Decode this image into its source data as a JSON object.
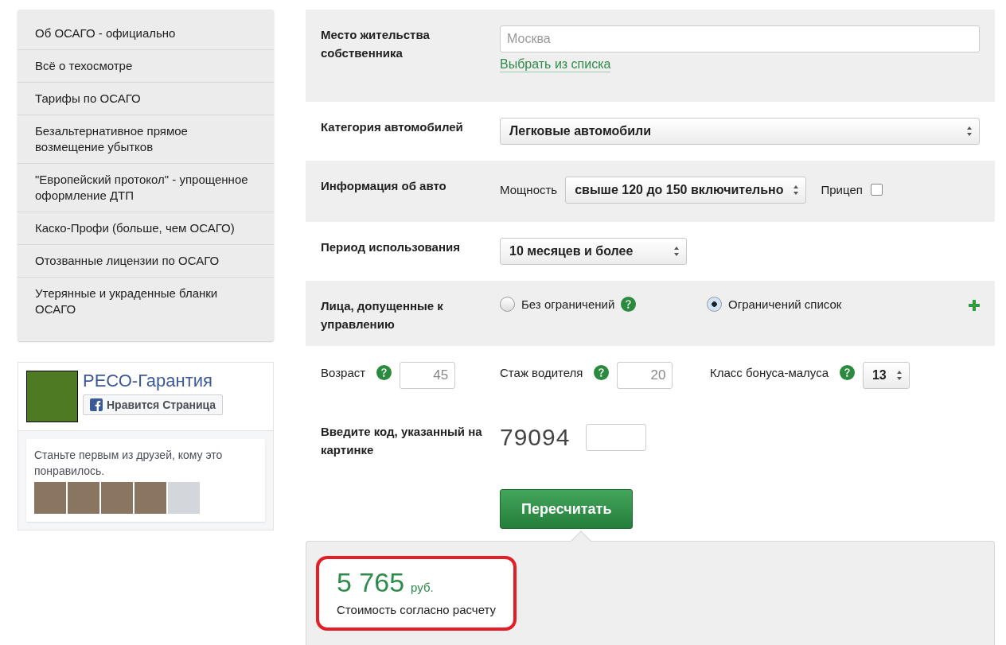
{
  "sidebar": {
    "items": [
      {
        "label": "Об ОСАГО - официально"
      },
      {
        "label": "Всё о техосмотре"
      },
      {
        "label": "Тарифы по ОСАГО"
      },
      {
        "label": "Безальтернативное прямое возмещение убытков"
      },
      {
        "label": "\"Европейский протокол\" - упрощенное оформление ДТП"
      },
      {
        "label": "Каско-Профи (больше, чем ОСАГО)"
      },
      {
        "label": "Отозванные лицензии по ОСАГО"
      },
      {
        "label": "Утерянные и украденные бланки ОСАГО"
      }
    ]
  },
  "social_widget": {
    "page_name": "РЕСО-Гарантия",
    "like_button": "Нравится Страница",
    "message": "Станьте первым из друзей, кому это понравилось.",
    "friends": [
      {
        "kind": "photo"
      },
      {
        "kind": "photo"
      },
      {
        "kind": "photo"
      },
      {
        "kind": "photo"
      },
      {
        "kind": "silhouette"
      }
    ]
  },
  "form": {
    "residence": {
      "label": "Место жительства собственника",
      "placeholder": "Москва",
      "link": "Выбрать из списка"
    },
    "category": {
      "label": "Категория автомобилей",
      "value": "Легковые автомобили"
    },
    "car_info": {
      "label": "Информация об авто",
      "power_label": "Мощность",
      "power_value": "свыше 120 до 150 включительно",
      "trailer_label": "Прицеп",
      "trailer_checked": false
    },
    "period": {
      "label": "Период использования",
      "value": "10 месяцев и более"
    },
    "drivers": {
      "label": "Лица, допущенные к управлению",
      "options": [
        {
          "label": "Без ограничений",
          "selected": false,
          "help": true
        },
        {
          "label": "Ограничений список",
          "selected": true,
          "help": false
        }
      ]
    },
    "driver_fields": [
      {
        "label": "Возраст",
        "kind": "input",
        "value": "45"
      },
      {
        "label": "Стаж водителя",
        "kind": "input",
        "value": "20"
      },
      {
        "label": "Класс бонуса-малуса",
        "kind": "select",
        "value": "13"
      }
    ],
    "captcha": {
      "label": "Введите код, указанный на картинке",
      "code": "79094"
    },
    "submit": "Пересчитать"
  },
  "result": {
    "amount": "5 765",
    "currency": "руб.",
    "caption": "Стоимость согласно расчету",
    "highlighted": true
  }
}
